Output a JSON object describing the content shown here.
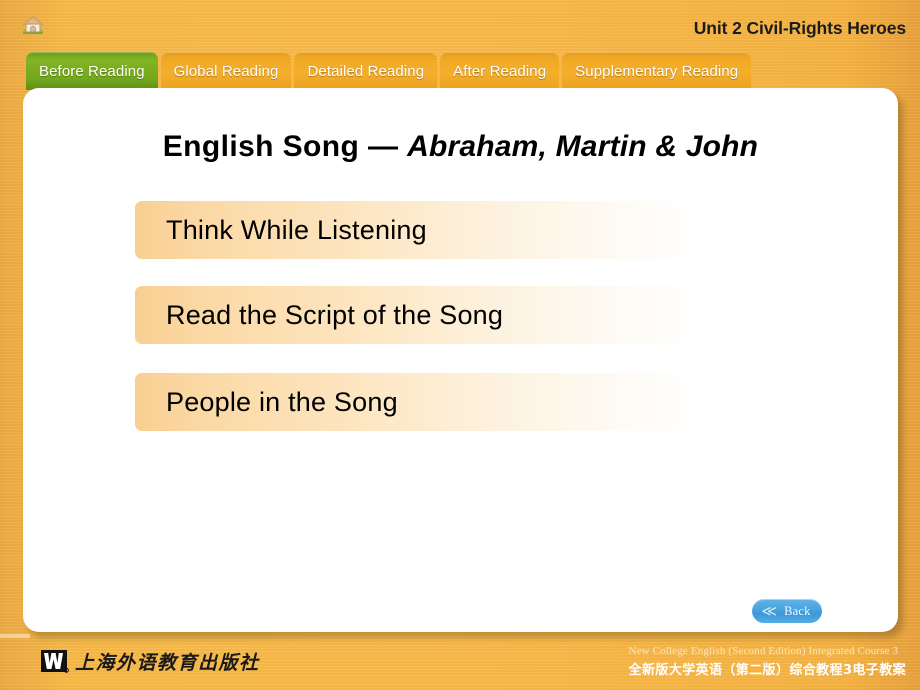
{
  "header": {
    "home_icon": "home-icon",
    "unit_title": "Unit 2 Civil-Rights Heroes"
  },
  "tabs": [
    {
      "label": "Before Reading",
      "active": true
    },
    {
      "label": "Global Reading",
      "active": false
    },
    {
      "label": "Detailed Reading",
      "active": false
    },
    {
      "label": "After Reading",
      "active": false
    },
    {
      "label": "Supplementary Reading",
      "active": false
    }
  ],
  "slide": {
    "title_plain": "English Song — ",
    "title_italic": "Abraham, Martin & John",
    "menu_items": [
      {
        "label": "Think While Listening"
      },
      {
        "label": "Read the Script of the Song"
      },
      {
        "label": "People in the Song"
      }
    ]
  },
  "back_button": {
    "label": "Back",
    "icon": "double-chevron-left-icon",
    "chevron": "≪"
  },
  "footer": {
    "publisher_logo": "w-logo-icon",
    "publisher_name": "上海外语教育出版社",
    "course_en": "New College English (Second Edition) Integrated Course 3",
    "course_cn": "全新版大学英语（第二版）综合教程3电子教案"
  },
  "colors": {
    "background_orange": "#f5ad3a",
    "tab_active_green": "#74a81d",
    "tab_inactive_orange": "#f0a925",
    "panel_white": "#ffffff",
    "menu_bar_start": "#f8cf92",
    "menu_bar_end": "#ffffff",
    "back_button_blue": "#4aa5e0"
  }
}
